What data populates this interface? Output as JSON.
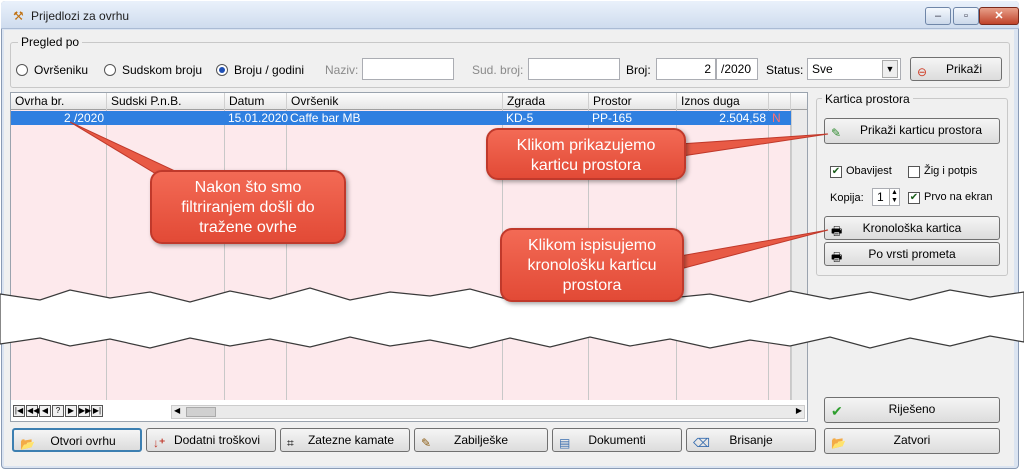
{
  "window": {
    "title": "Prijedlozi za ovrhu",
    "controls": [
      "–",
      "▫",
      "✕"
    ]
  },
  "filter": {
    "legend": "Pregled po",
    "options": [
      "Ovršeniku",
      "Sudskom broju",
      "Broju / godini"
    ],
    "selected_index": 2,
    "naziv_label": "Naziv:",
    "naziv_value": "",
    "sud_broj_label": "Sud. broj:",
    "sud_broj_value": "",
    "broj_label": "Broj:",
    "broj_value": "2",
    "godina_value": "/2020",
    "status_label": "Status:",
    "status_value": "Sve",
    "prikazi_label": "Prikaži"
  },
  "grid": {
    "headers": [
      "Ovrha br.",
      "Sudski P.n.B.",
      "Datum",
      "Ovršenik",
      "Zgrada",
      "Prostor",
      "Iznos duga"
    ],
    "rows": [
      {
        "ovrha_br": "2 /2020",
        "sudski": "",
        "datum": "15.01.2020",
        "ovrsenik": "Caffe bar MB",
        "zgrada": "KD-5",
        "prostor": "PP-165",
        "iznos": "2.504,58",
        "flag": "N"
      }
    ]
  },
  "kartica": {
    "legend": "Kartica prostora",
    "prikazi_label": "Prikaži karticu prostora",
    "obavijest_label": "Obavijest",
    "obavijest_checked": true,
    "zig_label": "Žig i potpis",
    "zig_checked": false,
    "kopija_label": "Kopija:",
    "kopija_value": "1",
    "prvo_label": "Prvo na ekran",
    "prvo_checked": true,
    "kronoloska_label": "Kronološka kartica",
    "po_vrsti_label": "Po vrsti prometa"
  },
  "callouts": {
    "left": "Nakon što smo filtriranjem došli do tražene ovrhe",
    "top_right": "Klikom prikazujemo karticu prostora",
    "bottom_right": "Klikom ispisujemo kronološku karticu prostora"
  },
  "navigator": [
    "|◀",
    "◀◀",
    "◀",
    "?",
    "▶",
    "▶▶",
    "▶|"
  ],
  "side_buttons": {
    "rijeseno": "Riješeno",
    "zatvori": "Zatvori"
  },
  "bottom_buttons": {
    "otvori": "Otvori ovrhu",
    "dodatni": "Dodatni troškovi",
    "zatezne": "Zatezne kamate",
    "zabiljeske": "Zabilješke",
    "dokumenti": "Dokumenti",
    "brisanje": "Brisanje"
  },
  "colors": {
    "selection": "#2f7fe0",
    "callout": "#e85a45",
    "row_tint": "#fde9ec"
  }
}
